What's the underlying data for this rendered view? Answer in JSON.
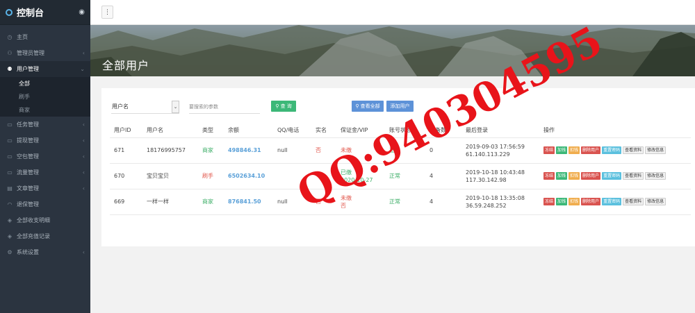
{
  "sidebar": {
    "brand": "控制台",
    "items": [
      {
        "icon": "clock-icon",
        "glyph": "◷",
        "label": "主页",
        "arrow": ""
      },
      {
        "icon": "user-icon",
        "glyph": "⚇",
        "label": "管理员管理",
        "arrow": "‹"
      },
      {
        "icon": "users-icon",
        "glyph": "⚉",
        "label": "用户管理",
        "arrow": "⌄"
      }
    ],
    "sub_items": [
      "全部",
      "刷手",
      "商家"
    ],
    "items2": [
      {
        "icon": "task-icon",
        "glyph": "▭",
        "label": "任务管理",
        "arrow": "‹"
      },
      {
        "icon": "withdraw-icon",
        "glyph": "▭",
        "label": "提现管理",
        "arrow": "‹"
      },
      {
        "icon": "package-icon",
        "glyph": "▭",
        "label": "空包管理",
        "arrow": "‹"
      },
      {
        "icon": "traffic-icon",
        "glyph": "▭",
        "label": "流量管理",
        "arrow": "‹"
      },
      {
        "icon": "article-icon",
        "glyph": "▤",
        "label": "文章管理",
        "arrow": "‹"
      },
      {
        "icon": "headset-icon",
        "glyph": "◠",
        "label": "退保管理",
        "arrow": ""
      },
      {
        "icon": "layers-icon",
        "glyph": "◈",
        "label": "全部收支明细",
        "arrow": ""
      },
      {
        "icon": "layers2-icon",
        "glyph": "◈",
        "label": "全部充值记录",
        "arrow": ""
      },
      {
        "icon": "gear-icon",
        "glyph": "⚙",
        "label": "系统设置",
        "arrow": "‹"
      }
    ]
  },
  "page_title": "全部用户",
  "search": {
    "field_selected": "用户名",
    "placeholder": "要搜索的参数",
    "query_label": "查 询",
    "view_all_label": "查看全部",
    "add_user_label": "添加用户"
  },
  "table": {
    "headers": [
      "用户ID",
      "用户名",
      "类型",
      "余额",
      "QQ/电话",
      "实名",
      "保证金/VIP",
      "账号状态",
      "设备数",
      "最后登录",
      "操作"
    ],
    "rows": [
      {
        "id": "671",
        "name": "18176995757",
        "type": "商家",
        "balance": "498846.31",
        "qq": "null",
        "realname": "否",
        "deposit1": "未缴",
        "deposit2": "",
        "status": "正常",
        "devices": "0",
        "login1": "2019-09-03 17:56:59",
        "login2": "61.140.113.229"
      },
      {
        "id": "670",
        "name": "宝贝宝贝",
        "type": "刷手",
        "balance": "6502634.10",
        "qq": "",
        "realname": "",
        "deposit1": "已缴",
        "deposit2": "2020-10-27",
        "status": "正常",
        "devices": "4",
        "login1": "2019-10-18 10:43:48",
        "login2": "117.30.142.98"
      },
      {
        "id": "669",
        "name": "一样一样",
        "type": "商家",
        "balance": "876841.50",
        "qq": "null",
        "realname": "否",
        "deposit1": "未缴",
        "deposit2": "否",
        "status": "正常",
        "devices": "4",
        "login1": "2019-10-18 13:35:08",
        "login2": "36.59.248.252"
      }
    ],
    "ops": [
      "冻结",
      "加钱",
      "扣钱",
      "删除用户",
      "重置密码",
      "查看资料",
      "修改信息"
    ]
  },
  "watermark": "QQ:940304595",
  "colors": {
    "accent_green": "#3cb878",
    "accent_blue": "#5d92d8",
    "accent_red": "#d9534f",
    "watermark": "#e8141a"
  }
}
